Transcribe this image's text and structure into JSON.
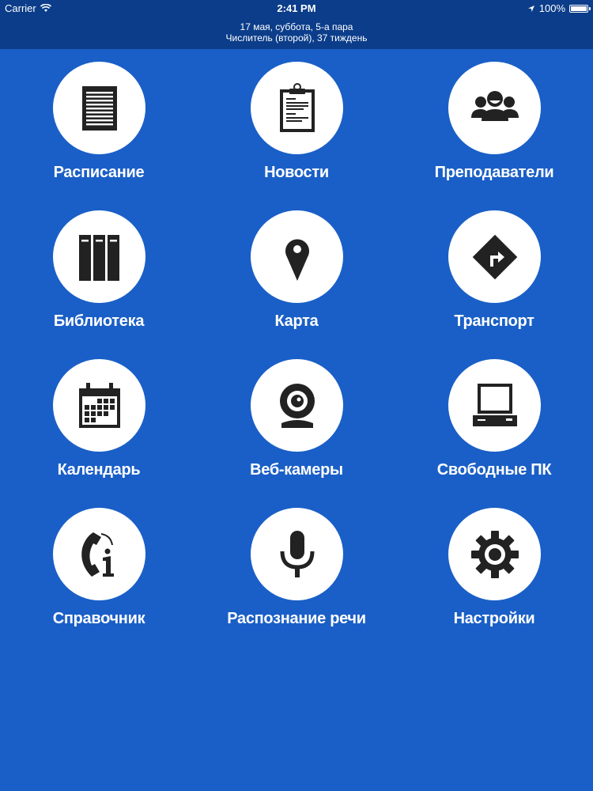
{
  "status_bar": {
    "carrier": "Carrier",
    "time": "2:41 PM",
    "battery": "100%",
    "icons": [
      "wifi-icon",
      "location-arrow-icon",
      "battery-icon"
    ]
  },
  "header": {
    "line1": "17 мая, суббота, 5-а пара",
    "line2": "Числитель (второй), 37 тиждень"
  },
  "menu": {
    "items": [
      {
        "label": "Расписание",
        "icon": "schedule-icon"
      },
      {
        "label": "Новости",
        "icon": "clipboard-news-icon"
      },
      {
        "label": "Преподаватели",
        "icon": "teachers-group-icon"
      },
      {
        "label": "Библиотека",
        "icon": "books-icon"
      },
      {
        "label": "Карта",
        "icon": "map-pin-icon"
      },
      {
        "label": "Транспорт",
        "icon": "road-sign-icon"
      },
      {
        "label": "Календарь",
        "icon": "calendar-icon"
      },
      {
        "label": "Веб-камеры",
        "icon": "webcam-icon"
      },
      {
        "label": "Свободные ПК",
        "icon": "computer-icon"
      },
      {
        "label": "Справочник",
        "icon": "phone-info-icon"
      },
      {
        "label": "Распознание речи",
        "icon": "microphone-icon"
      },
      {
        "label": "Настройки",
        "icon": "gear-icon"
      }
    ]
  },
  "colors": {
    "background": "#1a5fc7",
    "header_bg": "#0b3d8a",
    "icon_dark": "#222222",
    "circle": "#ffffff"
  }
}
